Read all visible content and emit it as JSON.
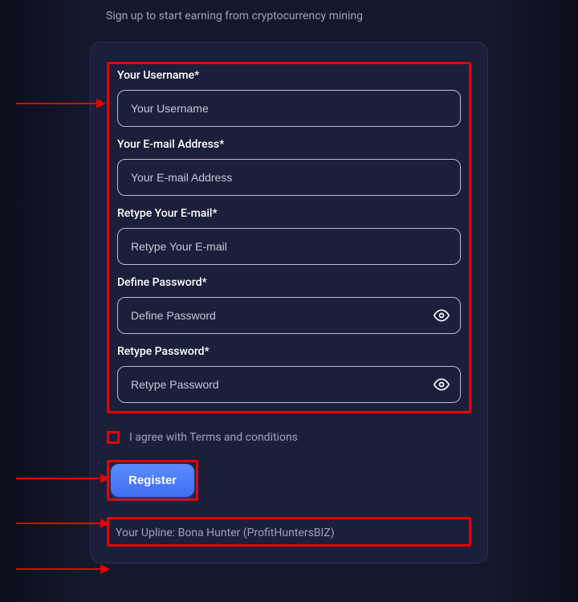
{
  "subtitle": "Sign up to start earning from cryptocurrency mining",
  "fields": {
    "username": {
      "label": "Your Username*",
      "placeholder": "Your Username",
      "value": ""
    },
    "email": {
      "label": "Your E-mail Address*",
      "placeholder": "Your E-mail Address",
      "value": ""
    },
    "email_retype": {
      "label": "Retype Your E-mail*",
      "placeholder": "Retype Your E-mail",
      "value": ""
    },
    "password": {
      "label": "Define Password*",
      "placeholder": "Define Password",
      "value": ""
    },
    "password_retype": {
      "label": "Retype Password*",
      "placeholder": "Retype Password",
      "value": ""
    }
  },
  "terms": {
    "label": "I agree with Terms and conditions",
    "checked": false
  },
  "register_label": "Register",
  "upline_text": "Your Upline: Bona Hunter (ProfitHuntersBIZ)",
  "annotations": {
    "highlight_color": "#e60000"
  }
}
